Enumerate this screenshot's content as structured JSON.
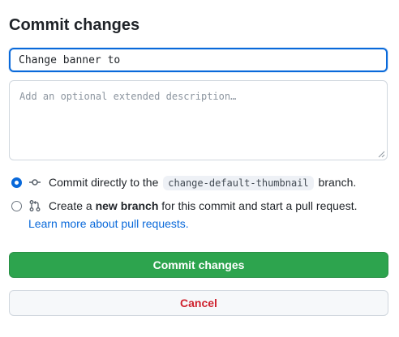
{
  "dialog": {
    "title": "Commit changes",
    "summary_value": "Change banner to",
    "description_placeholder": "Add an optional extended description…",
    "option_direct": {
      "prefix": "Commit directly to the",
      "branch": "change-default-thumbnail",
      "suffix": "branch.",
      "icon": "git-commit-icon",
      "selected": true
    },
    "option_new_branch": {
      "prefix": "Create a",
      "bold": "new branch",
      "suffix": "for this commit and start a pull request.",
      "icon": "git-pull-request-icon",
      "selected": false
    },
    "learn_more_link": "Learn more about pull requests.",
    "commit_button": "Commit changes",
    "cancel_button": "Cancel"
  },
  "colors": {
    "accent_blue": "#0969da",
    "primary_green": "#2da44e",
    "danger_red": "#cf222e"
  }
}
